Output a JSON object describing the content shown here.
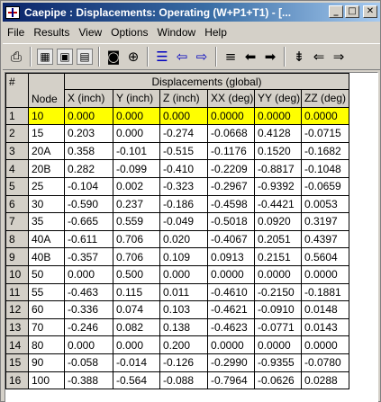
{
  "window": {
    "title": "Caepipe : Displacements: Operating (W+P1+T1) - [...",
    "controls": [
      "_",
      "□",
      "✕"
    ]
  },
  "menu": [
    "File",
    "Results",
    "View",
    "Options",
    "Window",
    "Help"
  ],
  "toolbar": {
    "icons": [
      "printer-icon",
      "grid-icon",
      "window-icon",
      "form-icon",
      "camera-icon",
      "zoom-icon",
      "list-icon",
      "arrow-left-outline-icon",
      "arrow-right-outline-icon",
      "lines-icon",
      "arrow-left-solid-icon",
      "arrow-right-solid-icon",
      "sort-icon",
      "arrow-left-icon",
      "arrow-right-icon"
    ]
  },
  "grid": {
    "corner": "#",
    "group_header": "Displacements (global)",
    "node_header": "Node",
    "columns": [
      "X (inch)",
      "Y (inch)",
      "Z (inch)",
      "XX (deg)",
      "YY (deg)",
      "ZZ (deg)"
    ],
    "selected_row": 1,
    "rows": [
      {
        "num": "1",
        "node": "10",
        "values": [
          "0.000",
          "0.000",
          "0.000",
          "0.0000",
          "0.0000",
          "0.0000"
        ]
      },
      {
        "num": "2",
        "node": "15",
        "values": [
          "0.203",
          "0.000",
          "-0.274",
          "-0.0668",
          "0.4128",
          "-0.0715"
        ]
      },
      {
        "num": "3",
        "node": "20A",
        "values": [
          "0.358",
          "-0.101",
          "-0.515",
          "-0.1176",
          "0.1520",
          "-0.1682"
        ]
      },
      {
        "num": "4",
        "node": "20B",
        "values": [
          "0.282",
          "-0.099",
          "-0.410",
          "-0.2209",
          "-0.8817",
          "-0.1048"
        ]
      },
      {
        "num": "5",
        "node": "25",
        "values": [
          "-0.104",
          "0.002",
          "-0.323",
          "-0.2967",
          "-0.9392",
          "-0.0659"
        ]
      },
      {
        "num": "6",
        "node": "30",
        "values": [
          "-0.590",
          "0.237",
          "-0.186",
          "-0.4598",
          "-0.4421",
          "0.0053"
        ]
      },
      {
        "num": "7",
        "node": "35",
        "values": [
          "-0.665",
          "0.559",
          "-0.049",
          "-0.5018",
          "0.0920",
          "0.3197"
        ]
      },
      {
        "num": "8",
        "node": "40A",
        "values": [
          "-0.611",
          "0.706",
          "0.020",
          "-0.4067",
          "0.2051",
          "0.4397"
        ]
      },
      {
        "num": "9",
        "node": "40B",
        "values": [
          "-0.357",
          "0.706",
          "0.109",
          "0.0913",
          "0.2151",
          "0.5604"
        ]
      },
      {
        "num": "10",
        "node": "50",
        "values": [
          "0.000",
          "0.500",
          "0.000",
          "0.0000",
          "0.0000",
          "0.0000"
        ]
      },
      {
        "num": "11",
        "node": "55",
        "values": [
          "-0.463",
          "0.115",
          "0.011",
          "-0.4610",
          "-0.2150",
          "-0.1881"
        ]
      },
      {
        "num": "12",
        "node": "60",
        "values": [
          "-0.336",
          "0.074",
          "0.103",
          "-0.4621",
          "-0.0910",
          "0.0148"
        ]
      },
      {
        "num": "13",
        "node": "70",
        "values": [
          "-0.246",
          "0.082",
          "0.138",
          "-0.4623",
          "-0.0771",
          "0.0143"
        ]
      },
      {
        "num": "14",
        "node": "80",
        "values": [
          "0.000",
          "0.000",
          "0.200",
          "0.0000",
          "0.0000",
          "0.0000"
        ]
      },
      {
        "num": "15",
        "node": "90",
        "values": [
          "-0.058",
          "-0.014",
          "-0.126",
          "-0.2990",
          "-0.9355",
          "-0.0780"
        ]
      },
      {
        "num": "16",
        "node": "100",
        "values": [
          "-0.388",
          "-0.564",
          "-0.088",
          "-0.7964",
          "-0.0626",
          "0.0288"
        ]
      }
    ]
  }
}
